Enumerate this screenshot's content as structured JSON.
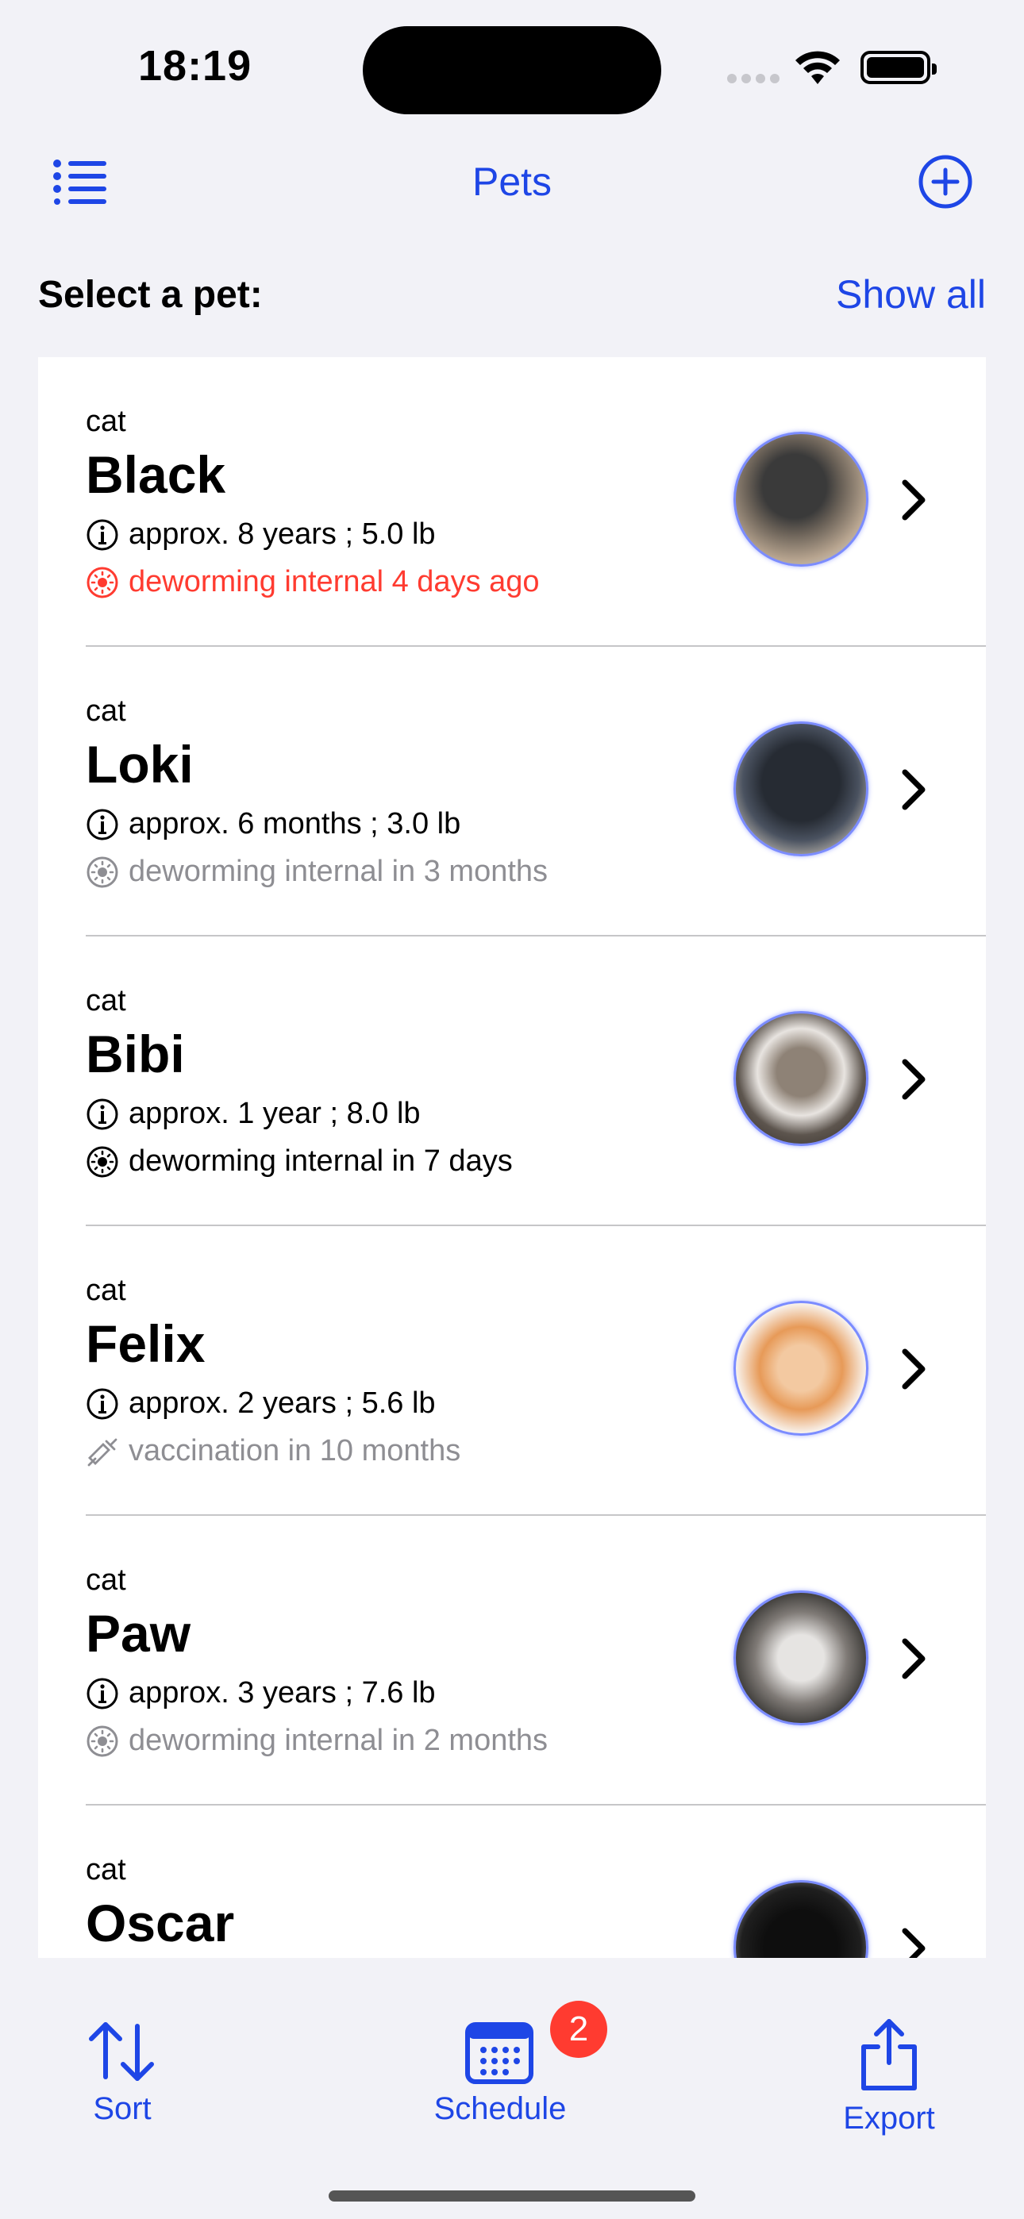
{
  "status_bar": {
    "time": "18:19"
  },
  "nav": {
    "title": "Pets"
  },
  "section": {
    "label": "Select a pet:",
    "show_all": "Show all"
  },
  "pets": [
    {
      "species": "cat",
      "name": "Black",
      "info": "approx. 8 years ; 5.0 lb",
      "event": "deworming internal 4 days ago",
      "event_type": "deworming",
      "event_state": "overdue"
    },
    {
      "species": "cat",
      "name": "Loki",
      "info": "approx. 6 months ; 3.0 lb",
      "event": "deworming internal in 3 months",
      "event_type": "deworming",
      "event_state": "future"
    },
    {
      "species": "cat",
      "name": "Bibi",
      "info": "approx. 1 year ; 8.0 lb",
      "event": "deworming internal in 7 days",
      "event_type": "deworming",
      "event_state": "soon"
    },
    {
      "species": "cat",
      "name": "Felix",
      "info": "approx. 2 years ; 5.6 lb",
      "event": "vaccination in 10 months",
      "event_type": "vaccination",
      "event_state": "future"
    },
    {
      "species": "cat",
      "name": "Paw",
      "info": "approx. 3 years ; 7.6 lb",
      "event": "deworming internal in 2 months",
      "event_type": "deworming",
      "event_state": "future"
    },
    {
      "species": "cat",
      "name": "Oscar",
      "info": "",
      "event": "",
      "event_type": "",
      "event_state": ""
    }
  ],
  "tabbar": {
    "sort": "Sort",
    "schedule": "Schedule",
    "schedule_badge": "2",
    "export": "Export"
  },
  "colors": {
    "accent": "#1e46e6",
    "overdue": "#ff3b30",
    "muted": "#8e8e93",
    "badge": "#ff3b30"
  },
  "icons": {
    "nav_left": "list-icon",
    "nav_right": "plus-circle-icon",
    "info": "info-circle-icon",
    "deworming": "sun-circle-icon",
    "vaccination": "syringe-icon",
    "chevron": "chevron-right-icon",
    "sort": "arrow-up-down-icon",
    "schedule": "calendar-icon",
    "export": "share-icon"
  }
}
